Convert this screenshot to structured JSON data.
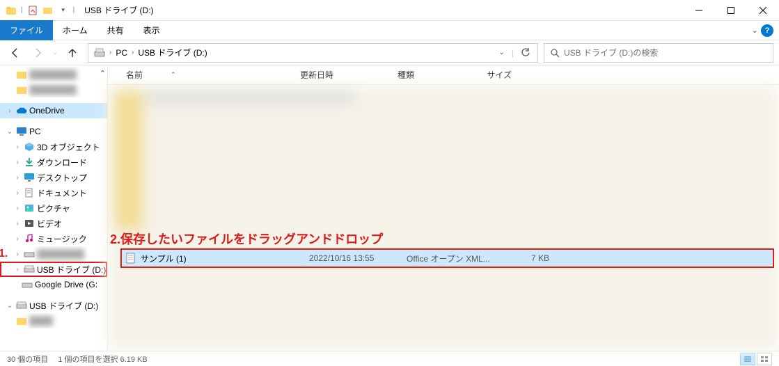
{
  "window": {
    "title": "USB ドライブ (D:)"
  },
  "ribbon": {
    "tabs": {
      "file": "ファイル",
      "home": "ホーム",
      "share": "共有",
      "view": "表示"
    }
  },
  "nav": {
    "breadcrumbs": {
      "pc": "PC",
      "drive": "USB ドライブ (D:)"
    },
    "search_placeholder": "USB ドライブ (D:)の検索"
  },
  "columns": {
    "name": "名前",
    "date": "更新日時",
    "type": "種類",
    "size": "サイズ"
  },
  "sidebar": {
    "onedrive": "OneDrive",
    "pc": "PC",
    "objects3d": "3D オブジェクト",
    "downloads": "ダウンロード",
    "desktop": "デスクトップ",
    "documents": "ドキュメント",
    "pictures": "ピクチャ",
    "videos": "ビデオ",
    "music": "ミュージック",
    "usb_drive": "USB ドライブ (D:)",
    "google_drive": "Google Drive (G:",
    "usb_drive2": "USB ドライブ (D:)"
  },
  "annotations": {
    "marker1": "1.",
    "text2": "2.保存したいファイルをドラッグアンドドロップ"
  },
  "file": {
    "name": "サンプル (1)",
    "date": "2022/10/16 13:55",
    "type": "Office オープン XML...",
    "size": "7 KB"
  },
  "status": {
    "count": "30 個の項目",
    "selection": "1 個の項目を選択 6.19 KB"
  }
}
